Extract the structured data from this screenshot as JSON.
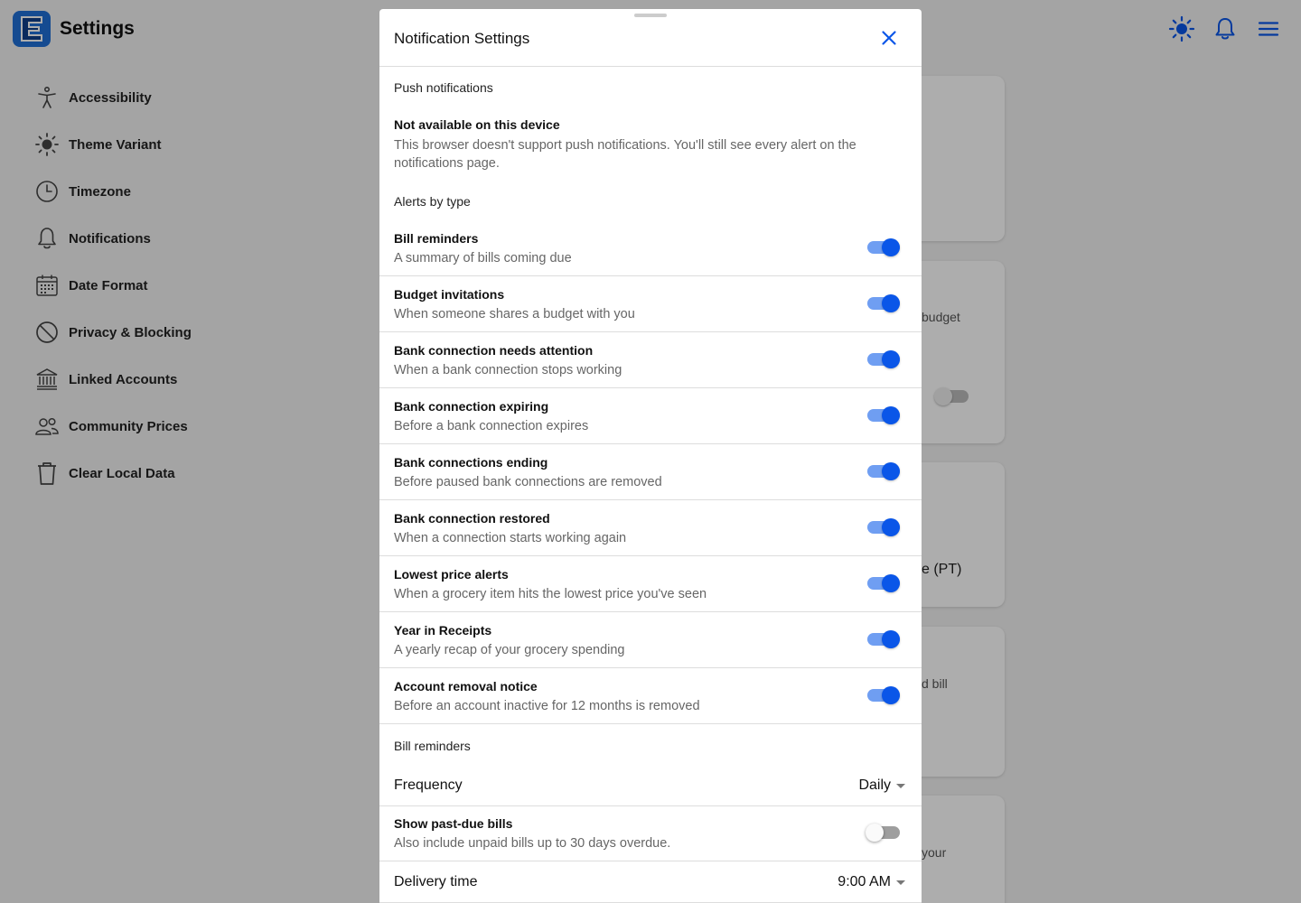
{
  "app": {
    "title": "Settings",
    "header_icons": [
      "sun-icon",
      "bell-icon",
      "menu-icon"
    ],
    "accent_color": "#0a56e8"
  },
  "sidebar": {
    "items": [
      {
        "label": "Accessibility",
        "icon": "accessibility-icon"
      },
      {
        "label": "Theme Variant",
        "icon": "sun-icon"
      },
      {
        "label": "Timezone",
        "icon": "clock-icon"
      },
      {
        "label": "Notifications",
        "icon": "bell-icon"
      },
      {
        "label": "Date Format",
        "icon": "calendar-icon"
      },
      {
        "label": "Privacy & Blocking",
        "icon": "block-icon"
      },
      {
        "label": "Linked Accounts",
        "icon": "bank-icon"
      },
      {
        "label": "Community Prices",
        "icon": "people-icon"
      },
      {
        "label": "Clear Local Data",
        "icon": "trash-icon"
      }
    ]
  },
  "background": {
    "snippets": [
      "budget",
      "e (PT)",
      "d bill",
      "your"
    ]
  },
  "modal": {
    "title": "Notification Settings",
    "push": {
      "heading": "Push notifications",
      "title": "Not available on this device",
      "description": "This browser doesn't support push notifications. You'll still see every alert on the notifications page."
    },
    "alerts_heading": "Alerts by type",
    "alerts": [
      {
        "title": "Bill reminders",
        "description": "A summary of bills coming due",
        "enabled": true
      },
      {
        "title": "Budget invitations",
        "description": "When someone shares a budget with you",
        "enabled": true
      },
      {
        "title": "Bank connection needs attention",
        "description": "When a bank connection stops working",
        "enabled": true
      },
      {
        "title": "Bank connection expiring",
        "description": "Before a bank connection expires",
        "enabled": true
      },
      {
        "title": "Bank connections ending",
        "description": "Before paused bank connections are removed",
        "enabled": true
      },
      {
        "title": "Bank connection restored",
        "description": "When a connection starts working again",
        "enabled": true
      },
      {
        "title": "Lowest price alerts",
        "description": "When a grocery item hits the lowest price you've seen",
        "enabled": true
      },
      {
        "title": "Year in Receipts",
        "description": "A yearly recap of your grocery spending",
        "enabled": true
      },
      {
        "title": "Account removal notice",
        "description": "Before an account inactive for 12 months is removed",
        "enabled": true
      }
    ],
    "bill_reminders": {
      "heading": "Bill reminders",
      "frequency_label": "Frequency",
      "frequency_value": "Daily",
      "past_due": {
        "title": "Show past-due bills",
        "description": "Also include unpaid bills up to 30 days overdue.",
        "enabled": false
      },
      "delivery_label": "Delivery time",
      "delivery_value": "9:00 AM"
    }
  }
}
